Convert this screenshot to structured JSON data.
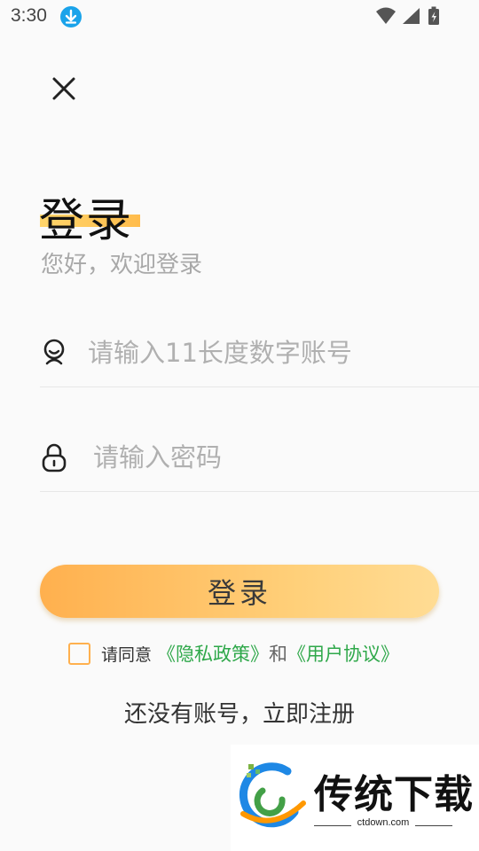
{
  "status_bar": {
    "time": "3:30",
    "icons": [
      "download-icon",
      "wifi-icon",
      "signal-icon",
      "battery-icon"
    ]
  },
  "header": {
    "close_icon": "close-icon"
  },
  "title": "登录",
  "subtitle": "您好，欢迎登录",
  "form": {
    "account": {
      "icon": "user-icon",
      "value": "",
      "placeholder": "请输入11长度数字账号"
    },
    "password": {
      "icon": "lock-icon",
      "value": "",
      "placeholder": "请输入密码"
    },
    "login_button": "登录"
  },
  "agreement": {
    "checked": false,
    "prefix": "请同意",
    "privacy_link": "《隐私政策》",
    "and": "和",
    "user_link": "《用户协议》"
  },
  "register_link": "还没有账号，立即注册",
  "watermark": {
    "name": "传统下载",
    "site": "ctdown.com"
  },
  "colors": {
    "accent": "#ffb04e",
    "link": "#2fa84a",
    "background": "#fafafa",
    "placeholder": "#b0b0b0"
  }
}
